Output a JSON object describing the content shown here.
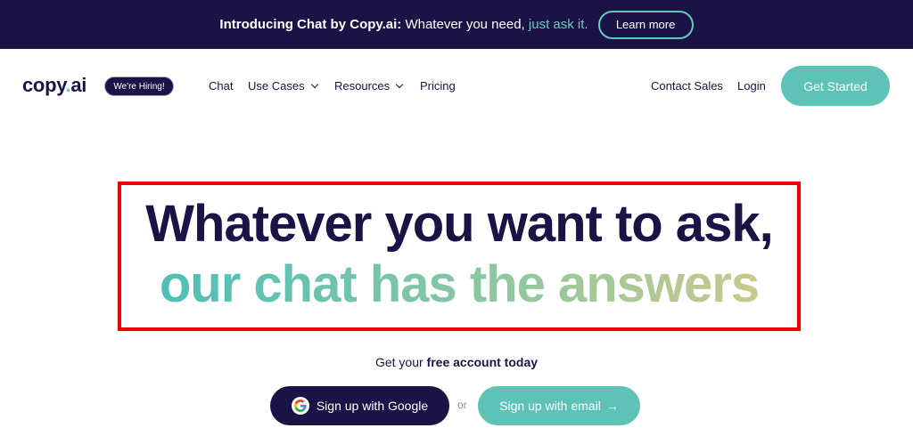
{
  "announcement": {
    "bold": "Introducing Chat by Copy.ai:",
    "text": " Whatever you need, ",
    "highlight": "just ask it.",
    "button": "Learn more"
  },
  "nav": {
    "logo_main": "copy",
    "logo_dot": ".",
    "logo_end": "ai",
    "hiring_badge": "We're Hiring!",
    "links": [
      {
        "label": "Chat"
      },
      {
        "label": "Use Cases"
      },
      {
        "label": "Resources"
      },
      {
        "label": "Pricing"
      }
    ],
    "contact_sales": "Contact Sales",
    "login": "Login",
    "get_started": "Get Started"
  },
  "hero": {
    "line1": "Whatever you want to ask,",
    "line2": "our chat has the answers",
    "sub_prefix": "Get your ",
    "sub_bold": "free account today",
    "google_button": "Sign up with Google",
    "or": "or",
    "email_button": "Sign up with email",
    "email_arrow": "→"
  },
  "colors": {
    "navy": "#1b1246",
    "teal": "#5ec2b7",
    "highlight_border": "#ee0000"
  },
  "icons": [
    "google-icon",
    "chevron-down-icon",
    "arrow-right-icon"
  ]
}
